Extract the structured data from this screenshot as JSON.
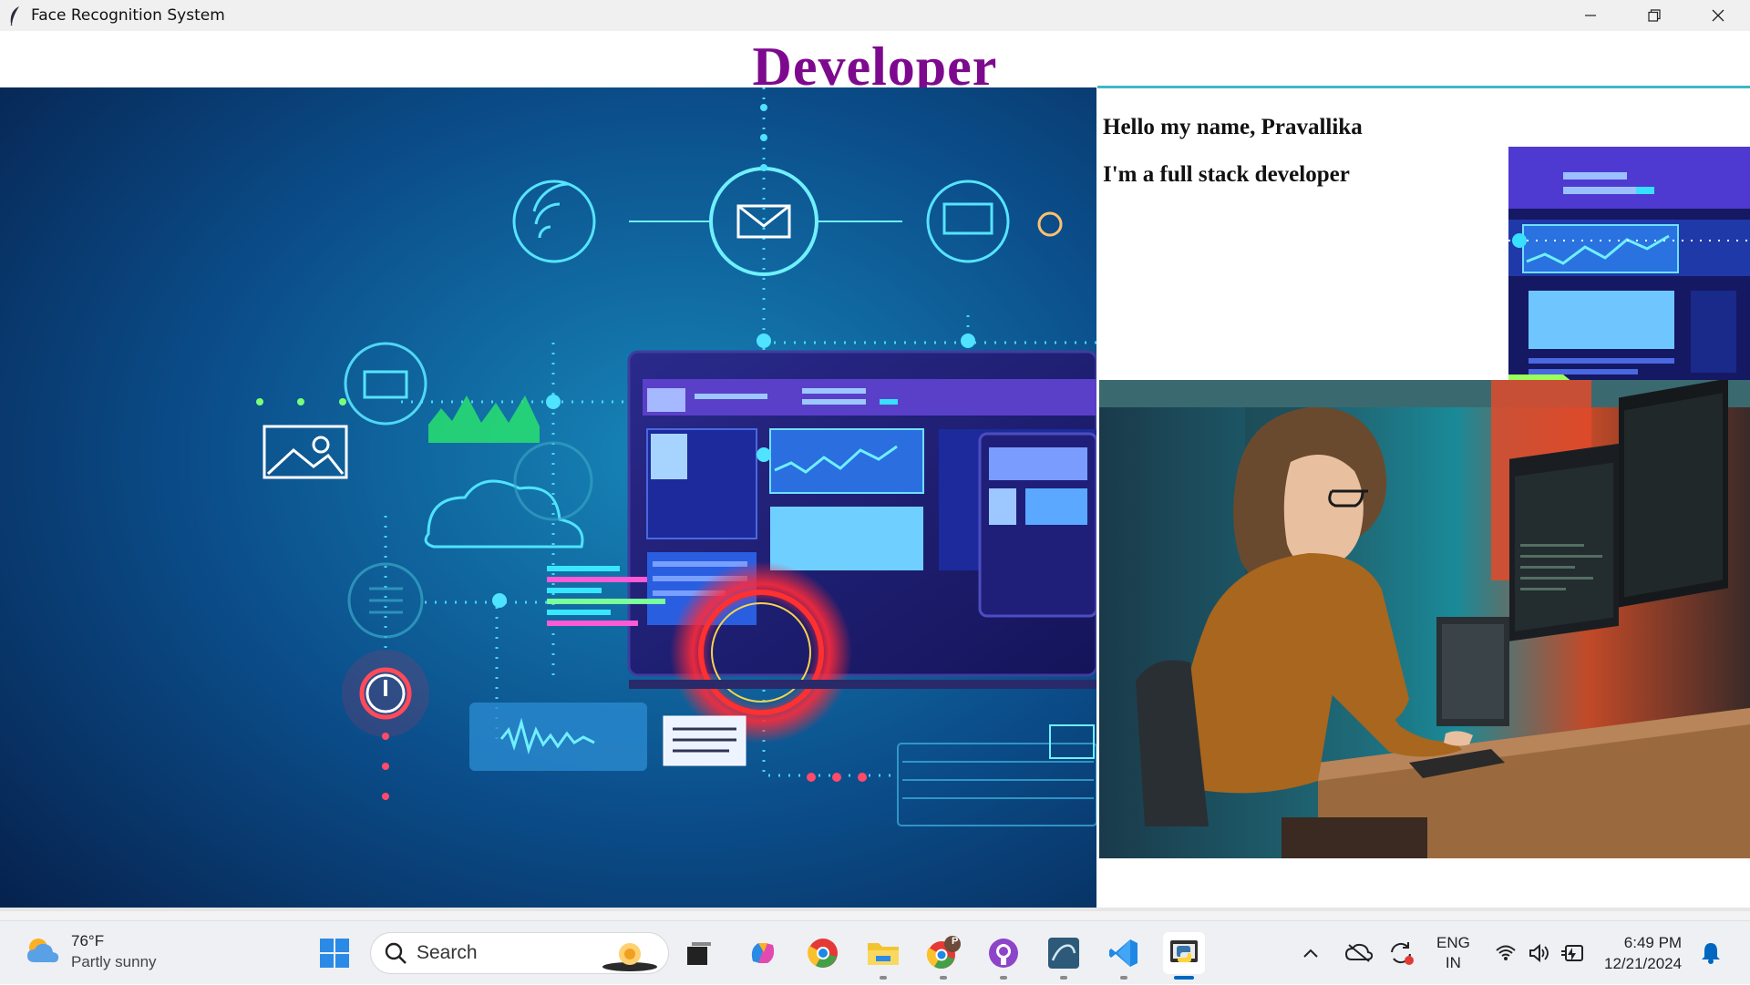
{
  "window": {
    "title": "Face Recognition System",
    "heading": "Developer",
    "greeting": "Hello my name, Pravallika",
    "role": "I'm a full stack developer"
  },
  "colors": {
    "heading": "#7d0a8e",
    "accent_rule": "#3fb8c7",
    "hero_bg": "#0a3d73"
  },
  "images": {
    "hero": "technology-dashboard-illustration",
    "thumb": "dashboard-ui-thumbnail",
    "photo": "woman-coding-at-desk-photo"
  },
  "taskbar": {
    "weather_temp": "76°F",
    "weather_desc": "Partly sunny",
    "search_placeholder": "Search",
    "lang_top": "ENG",
    "lang_bottom": "IN",
    "time": "6:49 PM",
    "date": "12/21/2024",
    "chrome_profile_badge": "P",
    "apps": [
      "start-icon",
      "task-view-icon",
      "copilot-icon",
      "chrome-icon",
      "file-explorer-icon",
      "chrome-profile-icon",
      "github-desktop-icon",
      "mysql-workbench-icon",
      "vscode-icon",
      "python-icon"
    ]
  }
}
